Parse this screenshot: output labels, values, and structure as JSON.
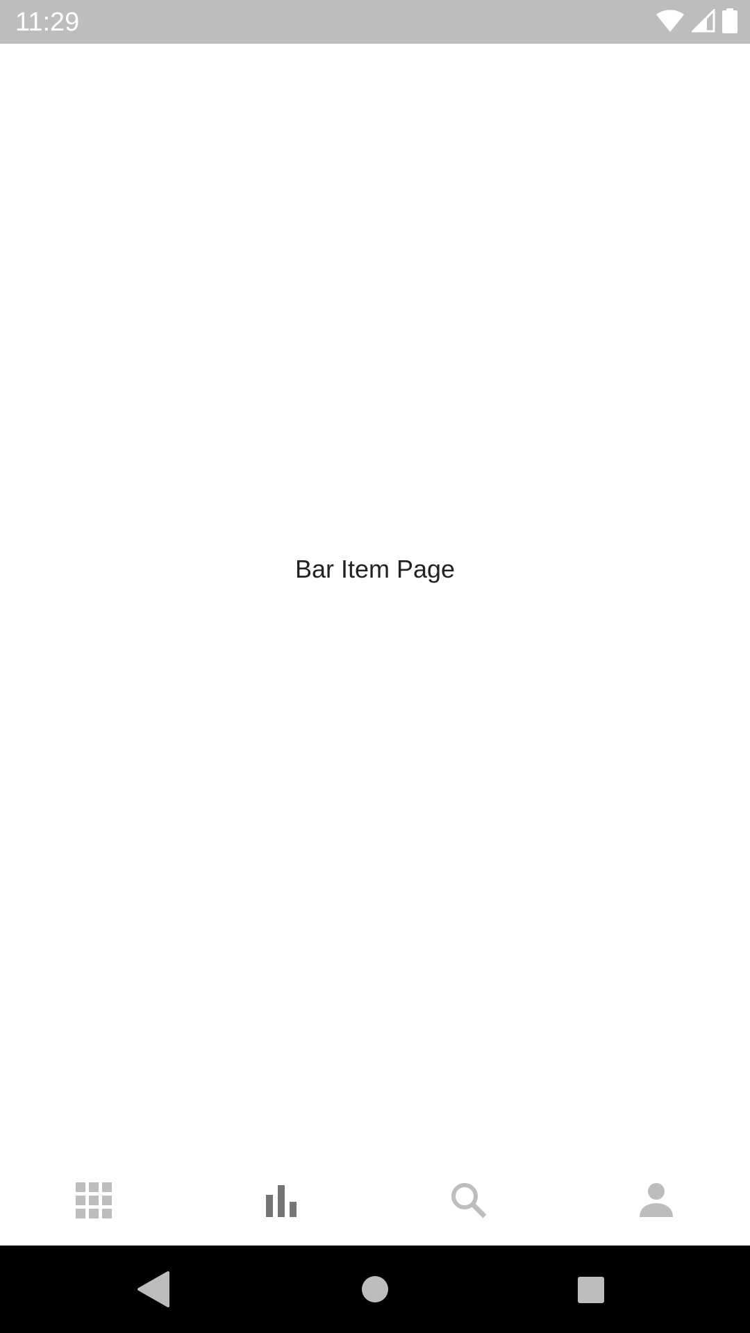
{
  "status_bar": {
    "time": "11:29",
    "icons": [
      "wifi-icon",
      "cell-signal-icon",
      "battery-icon"
    ],
    "background_color": "#bdbdbd"
  },
  "main": {
    "title": "Bar Item Page"
  },
  "bottom_nav": {
    "items": [
      {
        "icon": "apps-grid-icon",
        "selected": false
      },
      {
        "icon": "bar-chart-icon",
        "selected": true
      },
      {
        "icon": "search-icon",
        "selected": false
      },
      {
        "icon": "person-icon",
        "selected": false
      }
    ],
    "selected_color": "#757575",
    "unselected_color": "#bdbdbd"
  },
  "system_nav": {
    "buttons": [
      "back-icon",
      "home-icon",
      "recents-icon"
    ]
  }
}
